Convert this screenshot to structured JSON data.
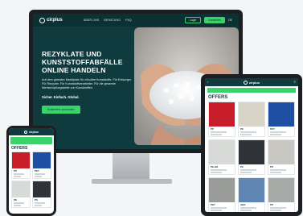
{
  "desktop": {
    "logo": "cirplus",
    "nav": [
      "ÜBER UNS",
      "BERATUNG",
      "FAQ"
    ],
    "login": "Login",
    "register": "Anmelden",
    "lang": "DE",
    "title": "REZYKLATE UND KUNSTSTOFFABFÄLLE ONLINE HANDELN",
    "subtitle": "Auf dem globalen Marktplatz für zirkuläre Kunststoffe. Für Entsorger. Für Recycler. Für Kunststoffverarbeiter. Für die gesamte Wertschöpfungskette von Kunststoffen.",
    "slogan": "Sicher. Einfach. Global.",
    "cta": "Kostenfrei anmelden"
  },
  "tablet": {
    "logo": "cirplus",
    "offers_label": "OFFERS",
    "cards": [
      {
        "tag": "PP",
        "color": "#c81e2c"
      },
      {
        "tag": "PE",
        "color": "#d9d4c8"
      },
      {
        "tag": "PET",
        "color": "#1f4fa3"
      },
      {
        "tag": "PE-HD",
        "color": "#d8dad8"
      },
      {
        "tag": "PA",
        "color": "#2f3236"
      },
      {
        "tag": "PS",
        "color": "#c8c7c2"
      },
      {
        "tag": "PET",
        "color": "#9a9c9a"
      },
      {
        "tag": "ABS",
        "color": "#5f86b5"
      },
      {
        "tag": "PP",
        "color": "#a7aaa7"
      }
    ]
  },
  "phone": {
    "logo": "cirplus",
    "offers_label": "OFFERS",
    "cards": [
      {
        "tag": "PP",
        "color": "#c81e2c"
      },
      {
        "tag": "PET",
        "color": "#1f4fa3"
      },
      {
        "tag": "PE",
        "color": "#d8dad8"
      },
      {
        "tag": "PS",
        "color": "#2f3236"
      }
    ]
  }
}
